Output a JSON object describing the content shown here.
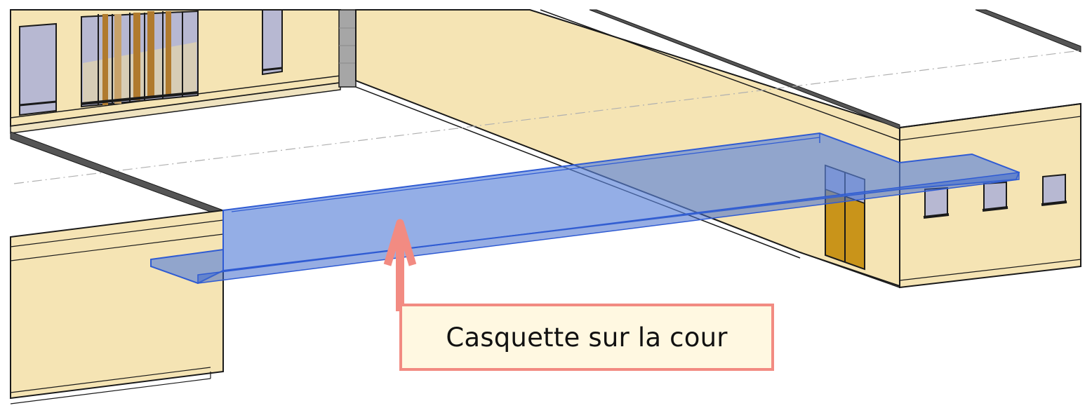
{
  "annotation": {
    "label": "Casquette sur la cour"
  },
  "colors": {
    "wall": "#f5e4b4",
    "wall_edge": "#1a1a1a",
    "parapet": "#555555",
    "glass": "#b7b8d2",
    "door": "#c9941a",
    "canopy": "#5b83d9",
    "callout_border": "#f28b82",
    "callout_fill": "#fff8e1",
    "arrow": "#f28b82"
  }
}
